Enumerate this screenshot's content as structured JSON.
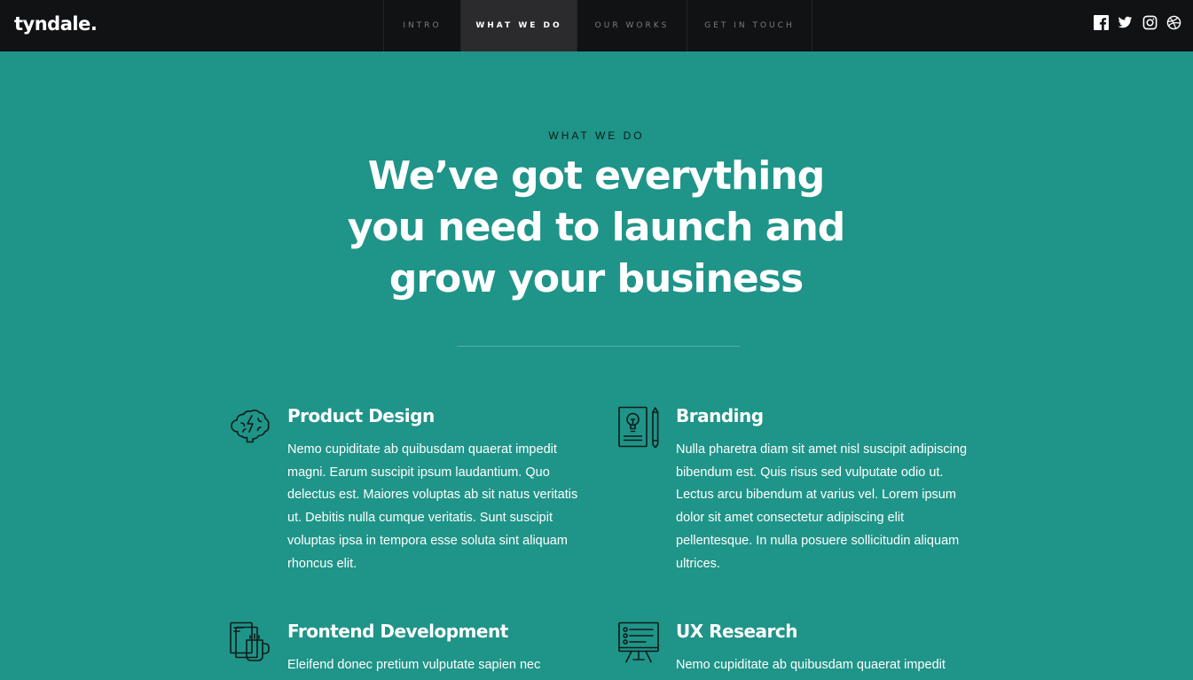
{
  "brand": {
    "logo": "tyndale."
  },
  "nav": {
    "items": [
      {
        "label": "INTRO"
      },
      {
        "label": "WHAT WE DO",
        "active": true
      },
      {
        "label": "OUR WORKS"
      },
      {
        "label": "GET IN TOUCH"
      }
    ]
  },
  "social": [
    "facebook-icon",
    "twitter-icon",
    "instagram-icon",
    "dribbble-icon"
  ],
  "section": {
    "label": "WHAT WE DO",
    "headline": "We’ve got everything you need to launch and grow your business"
  },
  "services": [
    {
      "icon": "brain-icon",
      "title": "Product Design",
      "text": "Nemo cupiditate ab quibusdam quaerat impedit magni. Earum suscipit ipsum laudantium. Quo delectus est. Maiores voluptas ab sit natus veritatis ut. Debitis nulla cumque veritatis. Sunt suscipit voluptas ipsa in tempora esse soluta sint aliquam rhoncus elit."
    },
    {
      "icon": "lightbulb-pencil-icon",
      "title": "Branding",
      "text": "Nulla pharetra diam sit amet nisl suscipit adipiscing bibendum est. Quis risus sed vulputate odio ut. Lectus arcu bibendum at varius vel. Lorem ipsum dolor sit amet consectetur adipiscing elit pellentesque. In nulla posuere sollicitudin aliquam ultrices."
    },
    {
      "icon": "documents-mug-icon",
      "title": "Frontend Development",
      "text": "Eleifend donec pretium vulputate sapien nec"
    },
    {
      "icon": "presentation-board-icon",
      "title": "UX Research",
      "text": "Nemo cupiditate ab quibusdam quaerat impedit"
    }
  ],
  "colors": {
    "page_background": "#1f9488",
    "topbar_background": "#111214",
    "nav_active_background": "#2b2b2e",
    "icon_stroke": "#0e1b1a"
  }
}
